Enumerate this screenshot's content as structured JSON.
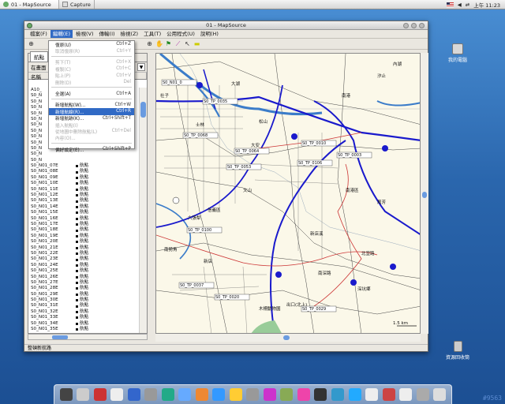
{
  "taskbar": {
    "tasks": [
      "01 - MapSource",
      "Capture"
    ],
    "clock": "上午 11:23"
  },
  "desktop": {
    "icons": [
      "我的電腦",
      "資源回收筒"
    ],
    "watermark": "#9563"
  },
  "window": {
    "title": "01 - MapSource",
    "menus": [
      "檔案(F)",
      "編輯(E)",
      "檢視(V)",
      "傳輸(I)",
      "檢視(Z)",
      "工具(T)",
      "公用程式(U)",
      "說明(H)"
    ],
    "status_text": "整頓新航路"
  },
  "left_panel": {
    "tab": "航點",
    "filter_label": "在畫面",
    "col_name": "名稱",
    "waypoints": [
      {
        "name": "A10_",
        "sym": ""
      },
      {
        "name": "S0_N",
        "sym": ""
      },
      {
        "name": "S0_N",
        "sym": ""
      },
      {
        "name": "S0_N",
        "sym": ""
      },
      {
        "name": "S0_N",
        "sym": ""
      },
      {
        "name": "S0_N",
        "sym": ""
      },
      {
        "name": "S0_N",
        "sym": ""
      },
      {
        "name": "S0_N",
        "sym": ""
      },
      {
        "name": "S0_N",
        "sym": ""
      },
      {
        "name": "S0_N",
        "sym": ""
      },
      {
        "name": "S0_N",
        "sym": ""
      },
      {
        "name": "S0_N",
        "sym": ""
      },
      {
        "name": "S0_N",
        "sym": ""
      },
      {
        "name": "S0_N01_07E",
        "sym": "航點"
      },
      {
        "name": "S0_N01_08E",
        "sym": "航點"
      },
      {
        "name": "S0_N01_09E",
        "sym": "航點"
      },
      {
        "name": "S0_N01_10E",
        "sym": "航點"
      },
      {
        "name": "S0_N01_11E",
        "sym": "航點"
      },
      {
        "name": "S0_N01_12E",
        "sym": "航點"
      },
      {
        "name": "S0_N01_13E",
        "sym": "航點"
      },
      {
        "name": "S0_N01_14E",
        "sym": "航點"
      },
      {
        "name": "S0_N01_15E",
        "sym": "航點"
      },
      {
        "name": "S0_N01_16E",
        "sym": "航點"
      },
      {
        "name": "S0_N01_17E",
        "sym": "航點"
      },
      {
        "name": "S0_N01_18E",
        "sym": "航點"
      },
      {
        "name": "S0_N01_19E",
        "sym": "航點"
      },
      {
        "name": "S0_N01_20E",
        "sym": "航點"
      },
      {
        "name": "S0_N01_21E",
        "sym": "航點"
      },
      {
        "name": "S0_N01_22E",
        "sym": "航點"
      },
      {
        "name": "S0_N01_23E",
        "sym": "航點"
      },
      {
        "name": "S0_N01_24E",
        "sym": "航點"
      },
      {
        "name": "S0_N01_25E",
        "sym": "航點"
      },
      {
        "name": "S0_N01_26E",
        "sym": "航點"
      },
      {
        "name": "S0_N01_27E",
        "sym": "航點"
      },
      {
        "name": "S0_N01_28E",
        "sym": "航點"
      },
      {
        "name": "S0_N01_29E",
        "sym": "航點"
      },
      {
        "name": "S0_N01_30E",
        "sym": "航點"
      },
      {
        "name": "S0_N01_31E",
        "sym": "航點"
      },
      {
        "name": "S0_N01_32E",
        "sym": "航點"
      },
      {
        "name": "S0_N01_33E",
        "sym": "航點"
      },
      {
        "name": "S0_N01_34E",
        "sym": "航點"
      },
      {
        "name": "S0_N01_35E",
        "sym": "航點"
      }
    ]
  },
  "edit_menu": {
    "items": [
      {
        "label": "復原(U)",
        "shortcut": "Ctrl+Z",
        "state": "normal"
      },
      {
        "label": "取消復原(R)",
        "shortcut": "Ctrl+Y",
        "state": "disabled"
      },
      {
        "sep": true
      },
      {
        "label": "剪下(T)",
        "shortcut": "Ctrl+X",
        "state": "disabled"
      },
      {
        "label": "複製(C)",
        "shortcut": "Ctrl+C",
        "state": "disabled"
      },
      {
        "label": "貼上(P)",
        "shortcut": "Ctrl+V",
        "state": "disabled"
      },
      {
        "label": "刪除(D)",
        "shortcut": "Del",
        "state": "disabled"
      },
      {
        "sep": true
      },
      {
        "label": "全選(A)",
        "shortcut": "Ctrl+A",
        "state": "normal"
      },
      {
        "sep": true
      },
      {
        "label": "新增航點(W)...",
        "shortcut": "Ctrl+W",
        "state": "normal"
      },
      {
        "label": "新增航線(R)...",
        "shortcut": "Ctrl+R",
        "state": "highlight"
      },
      {
        "label": "新增航跡(K)...",
        "shortcut": "Ctrl+Shift+T",
        "state": "normal"
      },
      {
        "label": "插入航點(I)",
        "shortcut": "",
        "state": "disabled"
      },
      {
        "label": "從地圖中刪除航點(L)",
        "shortcut": "Ctrl+Del",
        "state": "disabled"
      },
      {
        "label": "內容(O)...",
        "shortcut": "",
        "state": "disabled"
      },
      {
        "sep": true
      },
      {
        "label": "偏好設定(E)...",
        "shortcut": "Ctrl+Shift+P",
        "state": "normal"
      }
    ]
  },
  "map": {
    "labels": [
      "大湖",
      "社子",
      "士林",
      "汐止",
      "南港",
      "松山",
      "文山",
      "新店",
      "木柵動物園",
      "深坑鄉",
      "內湖",
      "大安",
      "信義區",
      "南港區",
      "新店溪",
      "六張犁",
      "南勢角",
      "萬芳",
      "出口(北上)",
      "南深路",
      "北宜路",
      "1.5 km"
    ],
    "route_labels": [
      "S0_N01_0",
      "S0_TP_0035",
      "S0_TP_0068",
      "S0_TP_0064",
      "S0_TP_0053",
      "S0_TP_0010",
      "S0_TP_0003",
      "S0_TP_0106",
      "S0_TP_0100",
      "S0_TP_0037",
      "S0_TP_0020",
      "S0_TP_0029"
    ]
  }
}
